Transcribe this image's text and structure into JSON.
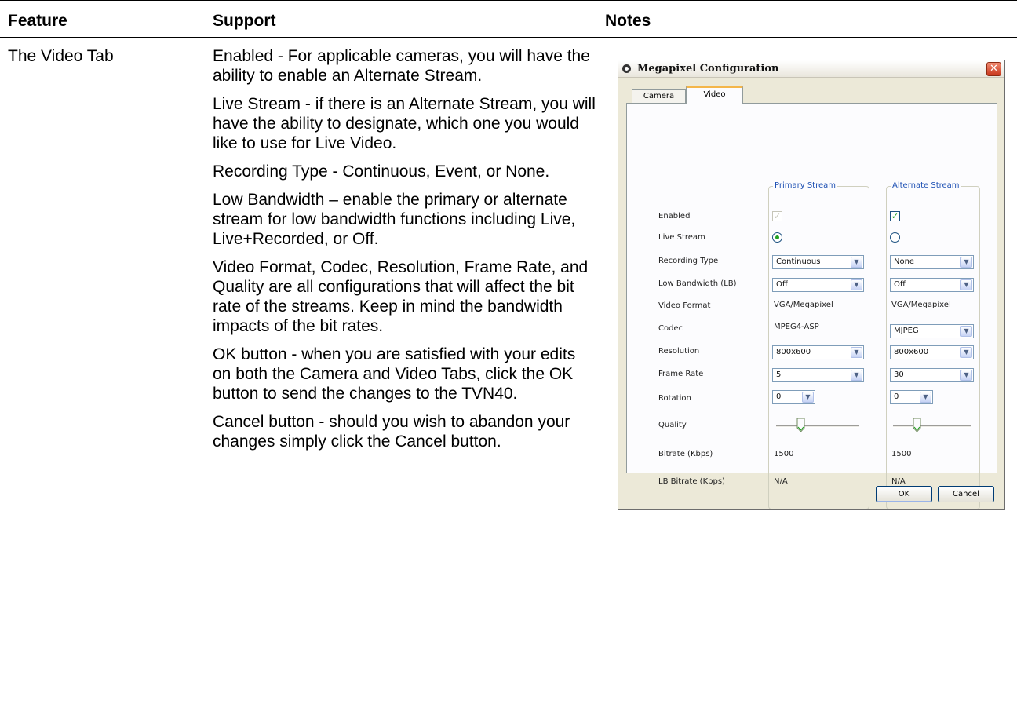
{
  "table": {
    "headers": [
      "Feature",
      "Support",
      "Notes"
    ],
    "feature": "The Video Tab",
    "support": [
      "Enabled - For applicable cameras, you will have the ability to enable an Alternate Stream.",
      "Live Stream - if there is an Alternate Stream, you will have the ability to designate, which one you would like to use for Live Video.",
      "Recording Type - Continuous, Event, or None.",
      "Low Bandwidth – enable the primary or alternate stream for low bandwidth functions including Live, Live+Recorded, or Off.",
      "Video Format, Codec, Resolution, Frame Rate, and Quality are all configurations that will affect the bit rate of the streams. Keep in mind the bandwidth impacts of the bit rates.",
      "OK button - when you are satisfied with your edits on both the Camera and Video Tabs, click the OK button to send the changes to the TVN40.",
      "Cancel button - should you wish to abandon your changes simply click the Cancel button."
    ]
  },
  "dialog": {
    "title": "Megapixel Configuration",
    "close_glyph": "✕",
    "tabs": [
      "Camera",
      "Video"
    ],
    "active_tab": "Video",
    "row_labels": {
      "enabled": "Enabled",
      "live_stream": "Live Stream",
      "recording_type": "Recording Type",
      "low_bandwidth": "Low Bandwidth (LB)",
      "video_format": "Video Format",
      "codec": "Codec",
      "resolution": "Resolution",
      "frame_rate": "Frame Rate",
      "rotation": "Rotation",
      "quality": "Quality",
      "bitrate": "Bitrate (Kbps)",
      "lb_bitrate": "LB Bitrate (Kbps)"
    },
    "primary": {
      "title": "Primary Stream",
      "enabled": true,
      "enabled_disabled": true,
      "live_stream_selected": true,
      "recording_type": "Continuous",
      "low_bandwidth": "Off",
      "video_format": "VGA/Megapixel",
      "codec": "MPEG4-ASP",
      "resolution": "800x600",
      "frame_rate": "5",
      "rotation": "0",
      "quality_fraction": 0.3,
      "bitrate": "1500",
      "lb_bitrate": "N/A"
    },
    "alternate": {
      "title": "Alternate Stream",
      "enabled": true,
      "live_stream_selected": false,
      "recording_type": "None",
      "low_bandwidth": "Off",
      "video_format": "VGA/Megapixel",
      "codec": "MJPEG",
      "resolution": "800x600",
      "frame_rate": "30",
      "rotation": "0",
      "quality_fraction": 0.3,
      "bitrate": "1500",
      "lb_bitrate": "N/A"
    },
    "buttons": {
      "ok": "OK",
      "cancel": "Cancel"
    },
    "check_glyph": "✓",
    "dropdown_glyph": "▼"
  }
}
